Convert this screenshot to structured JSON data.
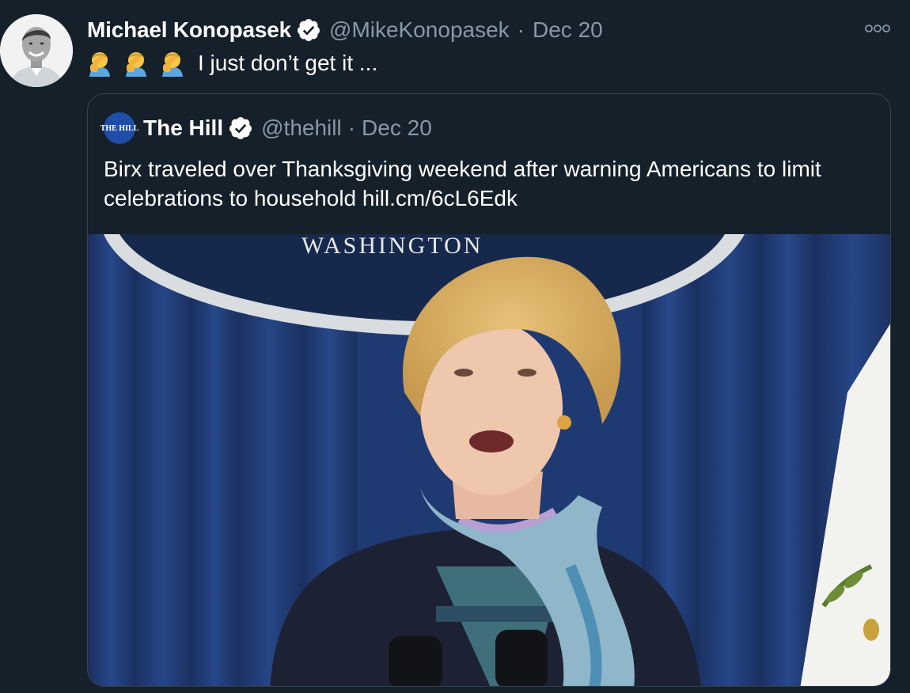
{
  "tweet": {
    "author_name": "Michael Konopasek",
    "handle": "@MikeKonopasek",
    "separator": "·",
    "date": "Dec 20",
    "text": "I just don’t get it ...",
    "emoji_count": 3,
    "emoji_icon": "facepalm-icon"
  },
  "quoted_tweet": {
    "author_name": "The Hill",
    "logo_text": "THE HILL",
    "handle": "@thehill",
    "separator": "·",
    "date": "Dec 20",
    "text": "Birx traveled over Thanksgiving weekend after warning Americans to limit celebrations to household hill.cm/6cL6Edk",
    "media_caption": "WASHINGTON"
  },
  "colors": {
    "background": "#15202b",
    "secondary_text": "#8899a6",
    "border": "#38444d",
    "verified": "#ffffff"
  }
}
